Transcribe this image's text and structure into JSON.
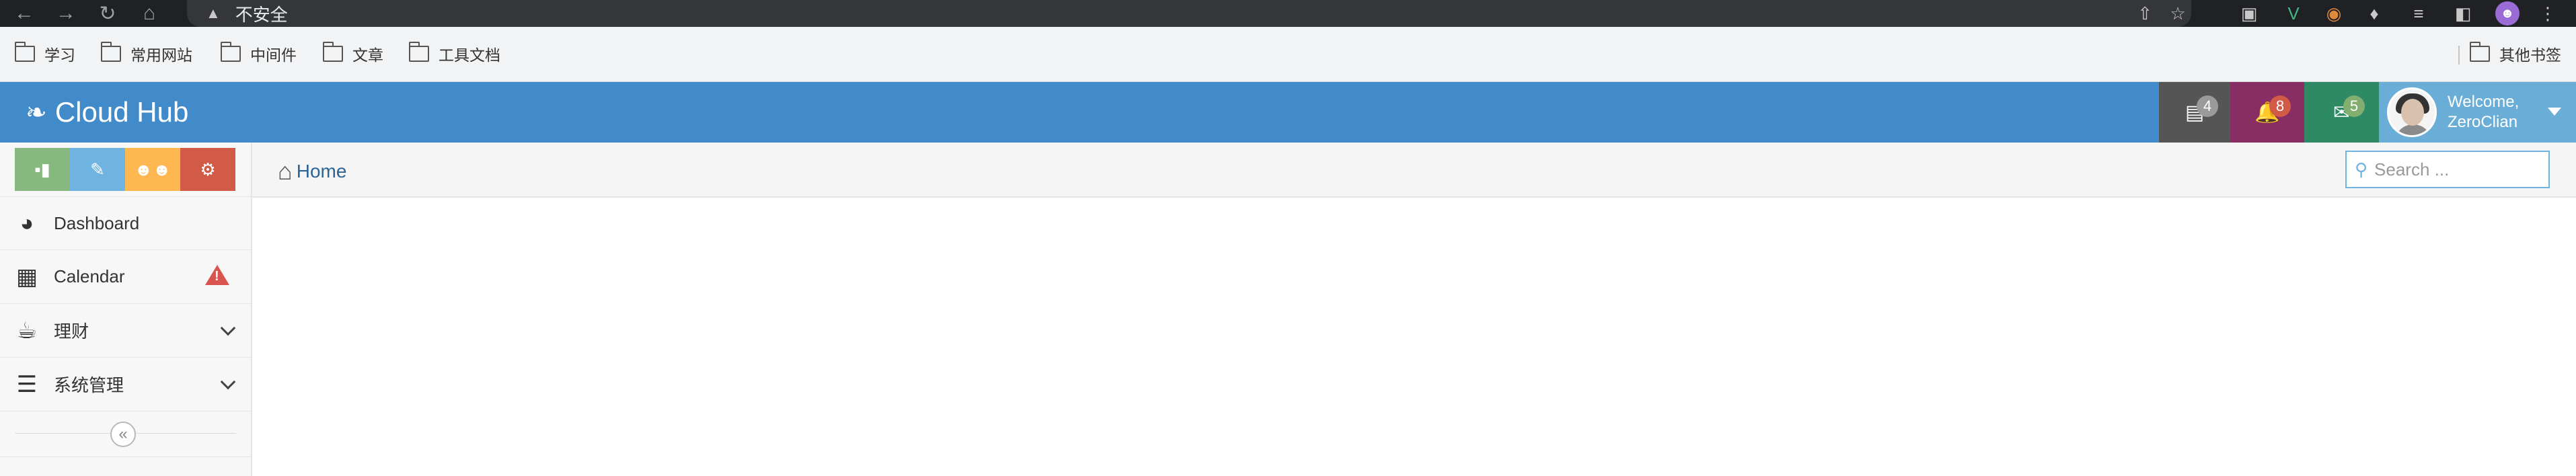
{
  "browser": {
    "address": {
      "security_label": "不安全"
    },
    "bookmarks": [
      "学习",
      "常用网站",
      "中间件",
      "文章",
      "工具文档"
    ],
    "other_bookmarks": "其他书签"
  },
  "header": {
    "brand": "Cloud Hub",
    "tasks_count": "4",
    "notifications_count": "8",
    "messages_count": "5",
    "welcome": "Welcome,",
    "username": "ZeroClian",
    "colors": {
      "bar": "#428bca",
      "tasks": "#555555",
      "notifications": "#892e65",
      "messages": "#2e8965",
      "user": "#6aaed8"
    }
  },
  "sidebar": {
    "shortcuts": [
      {
        "icon": "signal-icon",
        "color": "#87b87f"
      },
      {
        "icon": "pencil-icon",
        "color": "#6fb3e0"
      },
      {
        "icon": "users-icon",
        "color": "#ffb752"
      },
      {
        "icon": "cogs-icon",
        "color": "#d15b47"
      }
    ],
    "items": [
      {
        "label": "Dashboard",
        "icon": "dashboard-icon"
      },
      {
        "label": "Calendar",
        "icon": "calendar-icon",
        "badge_icon": "warning-icon"
      },
      {
        "label": "理财",
        "icon": "coffee-icon",
        "submenu": true
      },
      {
        "label": "系统管理",
        "icon": "list-icon",
        "submenu": true
      }
    ]
  },
  "breadcrumb": {
    "home": "Home"
  },
  "search": {
    "placeholder": "Search ..."
  }
}
